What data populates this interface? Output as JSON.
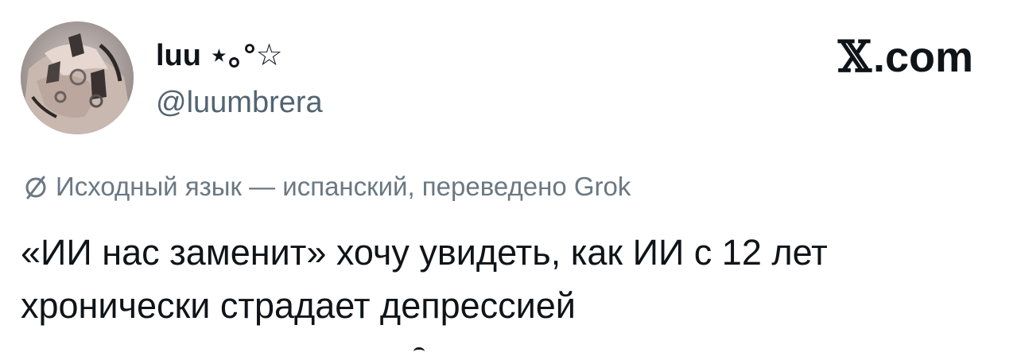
{
  "author": {
    "display_name": "luu ⋆｡°☆",
    "handle": "@luumbrera",
    "avatar_icon": "profile-avatar-hands-rings"
  },
  "brand": {
    "x_glyph": "𝕏",
    "domain": ".com"
  },
  "translation": {
    "icon": "translate-icon",
    "note": "Исходный язык — испанский, переведено Grok"
  },
  "tweet": {
    "lines": [
      "«ИИ нас заменит» хочу увидеть, как ИИ с 12 лет",
      "хронически страдает депрессией"
    ]
  },
  "colors": {
    "text_primary": "#0f1419",
    "text_secondary": "#536471",
    "background": "#ffffff"
  }
}
